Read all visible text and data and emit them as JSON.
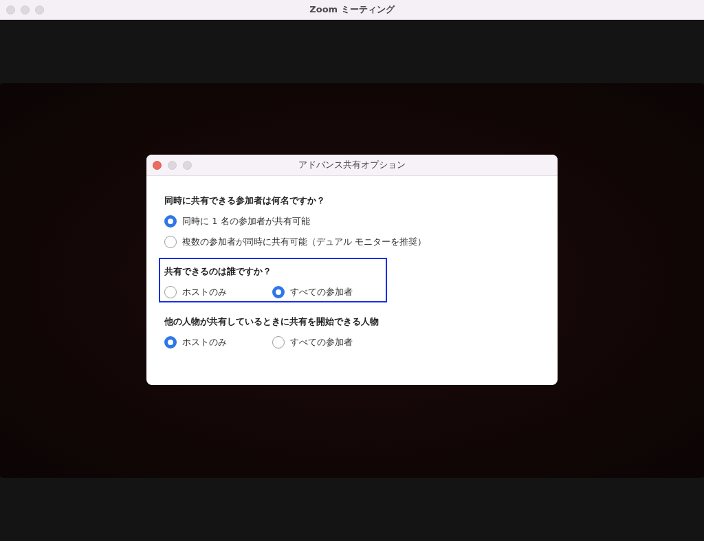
{
  "window": {
    "title": "Zoom ミーティング"
  },
  "dialog": {
    "title": "アドバンス共有オプション",
    "sections": [
      {
        "question": "同時に共有できる参加者は何名ですか？",
        "kind": "stacked",
        "highlighted": false,
        "options": [
          {
            "label": "同時に 1 名の参加者が共有可能",
            "selected": true
          },
          {
            "label": "複数の参加者が同時に共有可能（デュアル モニターを推奨）",
            "selected": false
          }
        ]
      },
      {
        "question": "共有できるのは誰ですか？",
        "kind": "row",
        "highlighted": true,
        "options": [
          {
            "label": "ホストのみ",
            "selected": false
          },
          {
            "label": "すべての参加者",
            "selected": true
          }
        ]
      },
      {
        "question": "他の人物が共有しているときに共有を開始できる人物",
        "kind": "row",
        "highlighted": false,
        "options": [
          {
            "label": "ホストのみ",
            "selected": true
          },
          {
            "label": "すべての参加者",
            "selected": false
          }
        ]
      }
    ]
  }
}
